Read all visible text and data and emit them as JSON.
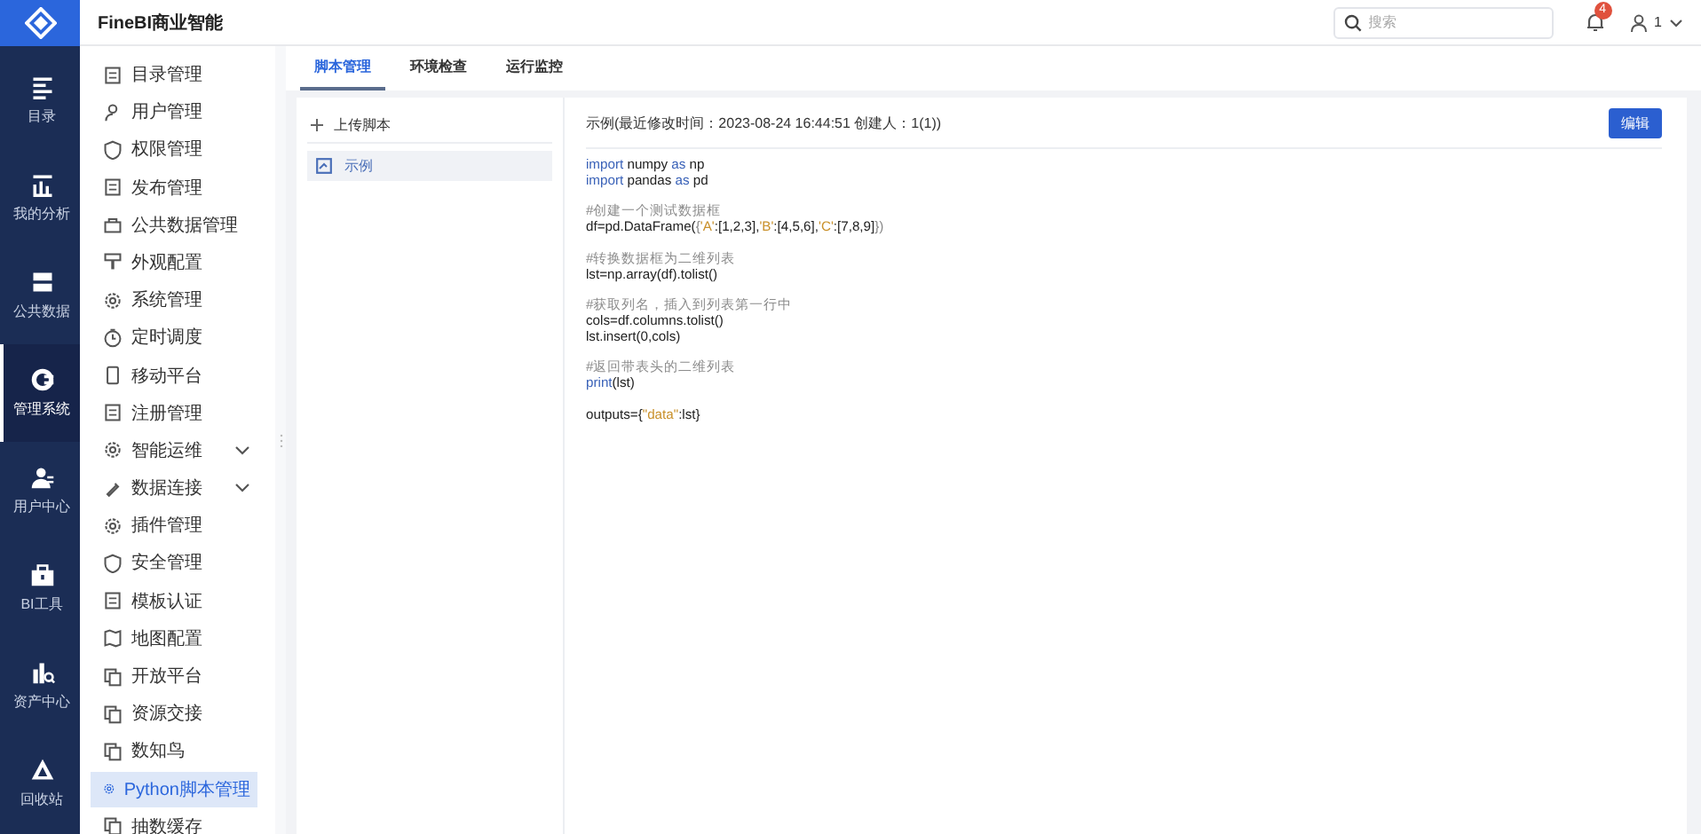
{
  "app": {
    "title": "FineBI商业智能"
  },
  "nav": [
    {
      "label": "目录",
      "selected": false
    },
    {
      "label": "我的分析",
      "selected": false
    },
    {
      "label": "公共数据",
      "selected": false
    },
    {
      "label": "管理系统",
      "selected": true
    },
    {
      "label": "用户中心",
      "selected": false
    },
    {
      "label": "BI工具",
      "selected": false
    },
    {
      "label": "资产中心",
      "selected": false
    },
    {
      "label": "回收站",
      "selected": false
    }
  ],
  "header": {
    "search": {
      "placeholder": "搜索"
    },
    "notifications": "4",
    "user": "1"
  },
  "menu": [
    {
      "label": "目录管理",
      "selected": false
    },
    {
      "label": "用户管理",
      "selected": false
    },
    {
      "label": "权限管理",
      "selected": false
    },
    {
      "label": "发布管理",
      "selected": false
    },
    {
      "label": "公共数据管理",
      "selected": false
    },
    {
      "label": "外观配置",
      "selected": false
    },
    {
      "label": "系统管理",
      "selected": false
    },
    {
      "label": "定时调度",
      "selected": false
    },
    {
      "label": "移动平台",
      "selected": false
    },
    {
      "label": "注册管理",
      "selected": false
    },
    {
      "label": "智能运维",
      "selected": false,
      "expanded": false
    },
    {
      "label": "数据连接",
      "selected": false,
      "expanded": false
    },
    {
      "label": "插件管理",
      "selected": false
    },
    {
      "label": "安全管理",
      "selected": false
    },
    {
      "label": "模板认证",
      "selected": false
    },
    {
      "label": "地图配置",
      "selected": false
    },
    {
      "label": "开放平台",
      "selected": false
    },
    {
      "label": "资源交接",
      "selected": false
    },
    {
      "label": "数知鸟",
      "selected": false
    },
    {
      "label": "Python脚本管理",
      "selected": true
    },
    {
      "label": "抽数缓存",
      "selected": false
    }
  ],
  "tabs": [
    {
      "label": "脚本管理",
      "selected": true
    },
    {
      "label": "环境检查",
      "selected": false
    },
    {
      "label": "运行监控",
      "selected": false
    }
  ],
  "scripts": {
    "upload": "上传脚本",
    "items": [
      {
        "label": "示例",
        "selected": true
      }
    ]
  },
  "editor": {
    "title": "示例(最近修改时间：2023-08-24 16:44:51 创建人：1(1))",
    "edit_button": "编辑",
    "code": [
      [
        [
          {
            "text": "import",
            "kind": "keyword"
          },
          {
            "text": " numpy ",
            "kind": "plain"
          },
          {
            "text": "as",
            "kind": "keyword"
          },
          {
            "text": " np",
            "kind": "plain"
          }
        ],
        [
          {
            "text": "import",
            "kind": "keyword"
          },
          {
            "text": " pandas ",
            "kind": "plain"
          },
          {
            "text": "as",
            "kind": "keyword"
          },
          {
            "text": " pd",
            "kind": "plain"
          }
        ]
      ],
      [
        [
          {
            "text": "#创建一个测试数据框",
            "kind": "comment"
          }
        ],
        [
          {
            "text": "df=pd.DataFrame(",
            "kind": "plain"
          },
          {
            "text": "{",
            "kind": "punct"
          },
          {
            "text": "'A'",
            "kind": "string"
          },
          {
            "text": ":[1,2,3],",
            "kind": "plain"
          },
          {
            "text": "'B'",
            "kind": "string"
          },
          {
            "text": ":[4,5,6],",
            "kind": "plain"
          },
          {
            "text": "'C'",
            "kind": "string"
          },
          {
            "text": ":[7,8,9]",
            "kind": "plain"
          },
          {
            "text": "})",
            "kind": "punct"
          }
        ]
      ],
      [
        [
          {
            "text": "#转换数据框为二维列表",
            "kind": "comment"
          }
        ],
        [
          {
            "text": "lst=np.array(df).tolist()",
            "kind": "plain"
          }
        ]
      ],
      [
        [
          {
            "text": "#获取列名，插入到列表第一行中",
            "kind": "comment"
          }
        ],
        [
          {
            "text": "cols=df.columns.tolist()",
            "kind": "plain"
          }
        ],
        [
          {
            "text": "lst.insert(0,cols)",
            "kind": "plain"
          }
        ]
      ],
      [
        [
          {
            "text": "#返回带表头的二维列表",
            "kind": "comment"
          }
        ],
        [
          {
            "text": "print",
            "kind": "keyword"
          },
          {
            "text": "(lst)",
            "kind": "plain"
          }
        ]
      ],
      [
        [
          {
            "text": "outputs={",
            "kind": "plain"
          },
          {
            "text": "\"data\"",
            "kind": "string"
          },
          {
            "text": ":lst}",
            "kind": "plain"
          }
        ]
      ]
    ]
  }
}
